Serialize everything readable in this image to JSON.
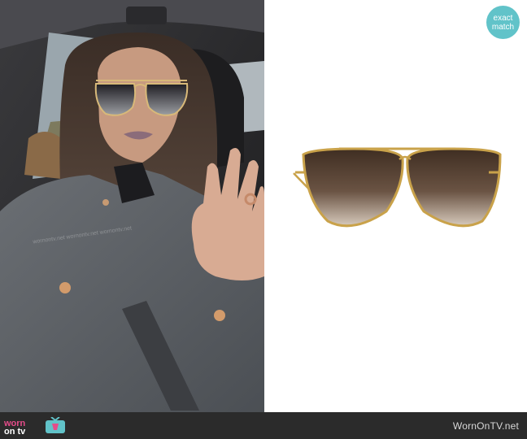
{
  "badge": {
    "line1": "exact",
    "line2": "match"
  },
  "footer": {
    "logo_line1": "worn",
    "logo_line2": "on tv",
    "site": "WornOnTV.net"
  },
  "watermark": {
    "text": "wornontv.net wornontv.net wornontv.net"
  },
  "colors": {
    "badge": "#61c3c9",
    "footer": "#2b2b2b",
    "logo_pink": "#e54c8a",
    "lens": "#5a4636",
    "frame": "#c9a24a"
  },
  "icons": [
    "tv-icon",
    "sunglasses-image",
    "person-photo"
  ]
}
